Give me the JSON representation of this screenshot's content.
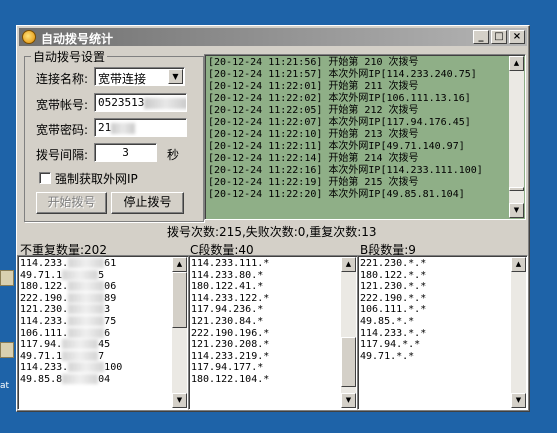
{
  "window": {
    "title": "自动拨号统计",
    "minimize_label": "_",
    "maximize_label": "□",
    "close_label": "×"
  },
  "settings": {
    "group_title": "自动拨号设置",
    "conn_name_label": "连接名称:",
    "conn_name_value": "宽带连接",
    "account_label": "宽带帐号:",
    "account_value": "0523513",
    "password_label": "宽带密码:",
    "password_value": "21",
    "interval_label": "拨号间隔:",
    "interval_value": "3",
    "interval_unit": "秒",
    "force_checkbox_label": "强制获取外网IP",
    "force_checked": false,
    "start_button": "开始拨号",
    "stop_button": "停止拨号"
  },
  "log": {
    "lines": [
      "[20-12-24 11:21:56] 开始第 210 次拨号",
      "[20-12-24 11:21:57] 本次外网IP[114.233.240.75]",
      "[20-12-24 11:22:01] 开始第 211 次拨号",
      "[20-12-24 11:22:02] 本次外网IP[106.111.13.16]",
      "[20-12-24 11:22:05] 开始第 212 次拨号",
      "[20-12-24 11:22:07] 本次外网IP[117.94.176.45]",
      "[20-12-24 11:22:10] 开始第 213 次拨号",
      "[20-12-24 11:22:11] 本次外网IP[49.71.140.97]",
      "[20-12-24 11:22:14] 开始第 214 次拨号",
      "[20-12-24 11:22:16] 本次外网IP[114.233.111.100]",
      "[20-12-24 11:22:19] 开始第 215 次拨号",
      "[20-12-24 11:22:20] 本次外网IP[49.85.81.104]"
    ]
  },
  "stats": {
    "summary": "拨号次数:215,失败次数:0,重复次数:13"
  },
  "lists": {
    "unique": {
      "header": "不重复数量:202",
      "items": [
        [
          "114.233.",
          "61"
        ],
        [
          "49.71.1",
          "5"
        ],
        [
          "180.122.",
          "06"
        ],
        [
          "222.190.",
          "89"
        ],
        [
          "121.230.",
          "3"
        ],
        [
          "114.233.",
          "75"
        ],
        [
          "106.111.",
          "6"
        ],
        [
          "117.94.",
          "45"
        ],
        [
          "49.71.1",
          "7"
        ],
        [
          "114.233.",
          "100"
        ],
        [
          "49.85.8",
          "04"
        ]
      ]
    },
    "c_segment": {
      "header": "C段数量:40",
      "items": [
        "114.233.111.*",
        "114.233.80.*",
        "180.122.41.*",
        "114.233.122.*",
        "117.94.236.*",
        "121.230.84.*",
        "222.190.196.*",
        "121.230.208.*",
        "114.233.219.*",
        "117.94.177.*",
        "180.122.104.*"
      ]
    },
    "b_segment": {
      "header": "B段数量:9",
      "items": [
        "221.230.*.*",
        "180.122.*.*",
        "121.230.*.*",
        "222.190.*.*",
        "106.111.*.*",
        "49.85.*.*",
        "114.233.*.*",
        "117.94.*.*",
        "49.71.*.*"
      ]
    }
  },
  "desktop": {
    "icon_text": "at"
  },
  "colors": {
    "desktop": "#1e63a8",
    "window": "#d4d0c8",
    "log_bg": "#8faf87"
  }
}
